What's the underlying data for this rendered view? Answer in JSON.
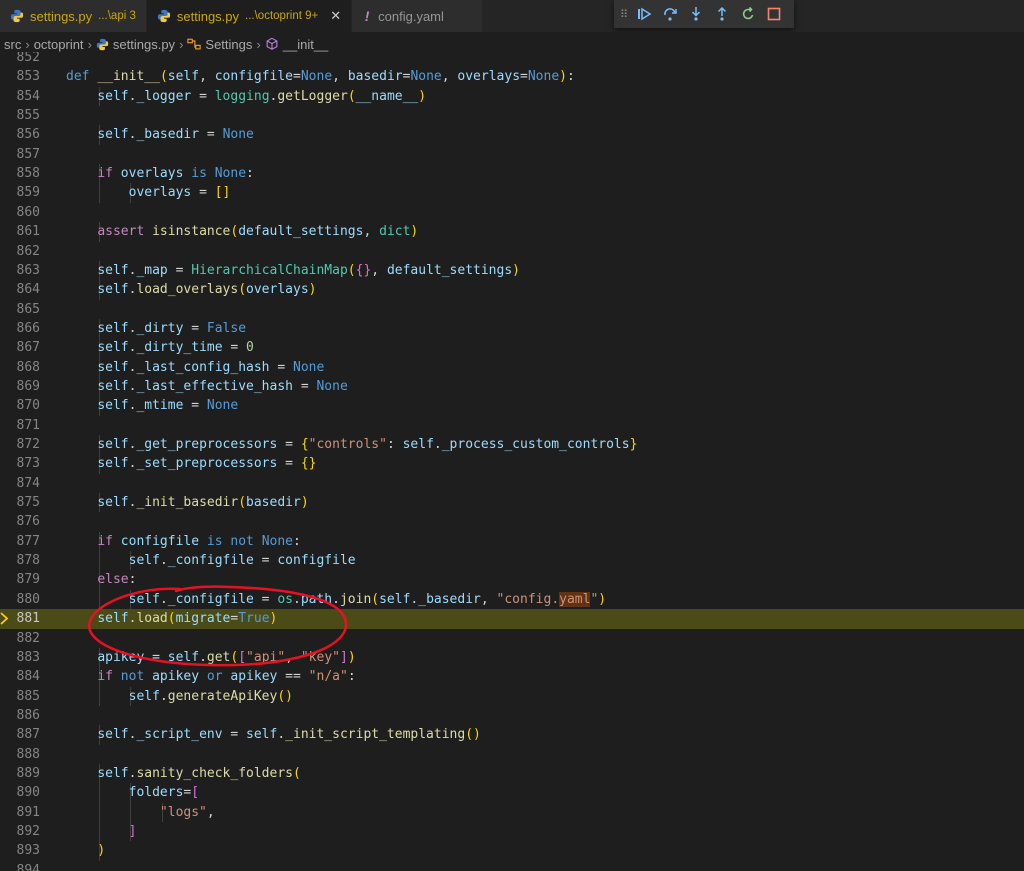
{
  "tabs": [
    {
      "name": "settings.py",
      "desc": "...\\api 3",
      "active": false,
      "modified": true
    },
    {
      "name": "settings.py",
      "desc": "...\\octoprint 9+",
      "active": true,
      "modified": true
    },
    {
      "name": "config.yaml",
      "desc": "",
      "active": false,
      "modified": false
    }
  ],
  "breadcrumbs": [
    "src",
    "octoprint",
    "settings.py",
    "Settings",
    "__init__"
  ],
  "current_line": "881",
  "code_lines": [
    {
      "n": "852",
      "html": ""
    },
    {
      "n": "853",
      "html": "    <span class='k'>def</span> <span class='f'>__init__</span><span class='b1'>(</span><span class='v'>self</span>, <span class='v'>configfile</span>=<span class='k'>None</span>, <span class='v'>basedir</span>=<span class='k'>None</span>, <span class='v'>overlays</span>=<span class='k'>None</span><span class='b1'>)</span>:"
    },
    {
      "n": "854",
      "html": "        <span class='v'>self</span>.<span class='v'>_logger</span> = <span class='c'>logging</span>.<span class='f'>getLogger</span><span class='b1'>(</span><span class='v'>__name__</span><span class='b1'>)</span>"
    },
    {
      "n": "855",
      "html": ""
    },
    {
      "n": "856",
      "html": "        <span class='v'>self</span>.<span class='v'>_basedir</span> = <span class='k'>None</span>"
    },
    {
      "n": "857",
      "html": ""
    },
    {
      "n": "858",
      "html": "        <span class='kc'>if</span> <span class='v'>overlays</span> <span class='k'>is</span> <span class='k'>None</span>:"
    },
    {
      "n": "859",
      "html": "            <span class='v'>overlays</span> = <span class='b1'>[]</span>"
    },
    {
      "n": "860",
      "html": ""
    },
    {
      "n": "861",
      "html": "        <span class='kc'>assert</span> <span class='f'>isinstance</span><span class='b1'>(</span><span class='v'>default_settings</span>, <span class='c'>dict</span><span class='b1'>)</span>"
    },
    {
      "n": "862",
      "html": ""
    },
    {
      "n": "863",
      "html": "        <span class='v'>self</span>.<span class='v'>_map</span> = <span class='c'>HierarchicalChainMap</span><span class='b1'>(</span><span class='b2'>{}</span>, <span class='v'>default_settings</span><span class='b1'>)</span>"
    },
    {
      "n": "864",
      "html": "        <span class='v'>self</span>.<span class='f'>load_overlays</span><span class='b1'>(</span><span class='v'>overlays</span><span class='b1'>)</span>"
    },
    {
      "n": "865",
      "html": ""
    },
    {
      "n": "866",
      "html": "        <span class='v'>self</span>.<span class='v'>_dirty</span> = <span class='k'>False</span>"
    },
    {
      "n": "867",
      "html": "        <span class='v'>self</span>.<span class='v'>_dirty_time</span> = <span class='n'>0</span>"
    },
    {
      "n": "868",
      "html": "        <span class='v'>self</span>.<span class='v'>_last_config_hash</span> = <span class='k'>None</span>"
    },
    {
      "n": "869",
      "html": "        <span class='v'>self</span>.<span class='v'>_last_effective_hash</span> = <span class='k'>None</span>"
    },
    {
      "n": "870",
      "html": "        <span class='v'>self</span>.<span class='v'>_mtime</span> = <span class='k'>None</span>"
    },
    {
      "n": "871",
      "html": ""
    },
    {
      "n": "872",
      "html": "        <span class='v'>self</span>.<span class='v'>_get_preprocessors</span> = <span class='b1'>{</span><span class='s'>\"controls\"</span>: <span class='v'>self</span>.<span class='v'>_process_custom_controls</span><span class='b1'>}</span>"
    },
    {
      "n": "873",
      "html": "        <span class='v'>self</span>.<span class='v'>_set_preprocessors</span> = <span class='b1'>{}</span>"
    },
    {
      "n": "874",
      "html": ""
    },
    {
      "n": "875",
      "html": "        <span class='v'>self</span>.<span class='f'>_init_basedir</span><span class='b1'>(</span><span class='v'>basedir</span><span class='b1'>)</span>"
    },
    {
      "n": "876",
      "html": ""
    },
    {
      "n": "877",
      "html": "        <span class='kc'>if</span> <span class='v'>configfile</span> <span class='k'>is not</span> <span class='k'>None</span>:"
    },
    {
      "n": "878",
      "html": "            <span class='v'>self</span>.<span class='v'>_configfile</span> = <span class='v'>configfile</span>"
    },
    {
      "n": "879",
      "html": "        <span class='kc'>else</span>:"
    },
    {
      "n": "880",
      "html": "            <span class='v'>self</span>.<span class='v'>_configfile</span> = <span class='c'>os</span>.<span class='v'>path</span>.<span class='f'>join</span><span class='b1'>(</span><span class='v'>self</span>.<span class='v'>_basedir</span>, <span class='s'>\"config.<span class='hl'>yaml</span>\"</span><span class='b1'>)</span>"
    },
    {
      "n": "881",
      "html": "        <span class='v'>self</span>.<span class='f'>load</span><span class='b1'>(</span><span class='v'>migrate</span>=<span class='k'>True</span><span class='b1'>)</span>"
    },
    {
      "n": "882",
      "html": ""
    },
    {
      "n": "883",
      "html": "        <span class='v'>apikey</span> = <span class='v'>self</span>.<span class='f'>get</span><span class='b1'>(</span><span class='b2'>[</span><span class='s'>\"api\"</span>, <span class='s'>\"key\"</span><span class='b2'>]</span><span class='b1'>)</span>"
    },
    {
      "n": "884",
      "html": "        <span class='kc'>if</span> <span class='k'>not</span> <span class='v'>apikey</span> <span class='k'>or</span> <span class='v'>apikey</span> == <span class='s'>\"n/a\"</span>:"
    },
    {
      "n": "885",
      "html": "            <span class='v'>self</span>.<span class='f'>generateApiKey</span><span class='b1'>()</span>"
    },
    {
      "n": "886",
      "html": ""
    },
    {
      "n": "887",
      "html": "        <span class='v'>self</span>.<span class='v'>_script_env</span> = <span class='v'>self</span>.<span class='f'>_init_script_templating</span><span class='b1'>()</span>"
    },
    {
      "n": "888",
      "html": ""
    },
    {
      "n": "889",
      "html": "        <span class='v'>self</span>.<span class='f'>sanity_check_folders</span><span class='b1'>(</span>"
    },
    {
      "n": "890",
      "html": "            <span class='v'>folders</span>=<span class='b2'>[</span>"
    },
    {
      "n": "891",
      "html": "                <span class='s'>\"logs\"</span>,"
    },
    {
      "n": "892",
      "html": "            <span class='b2'>]</span>"
    },
    {
      "n": "893",
      "html": "        <span class='b1'>)</span>"
    },
    {
      "n": "894",
      "html": ""
    }
  ],
  "colors": {
    "current_line_bg": "#4b4b18",
    "annotation": "#e81123",
    "breakpoint_arrow": "#ffcc00"
  }
}
